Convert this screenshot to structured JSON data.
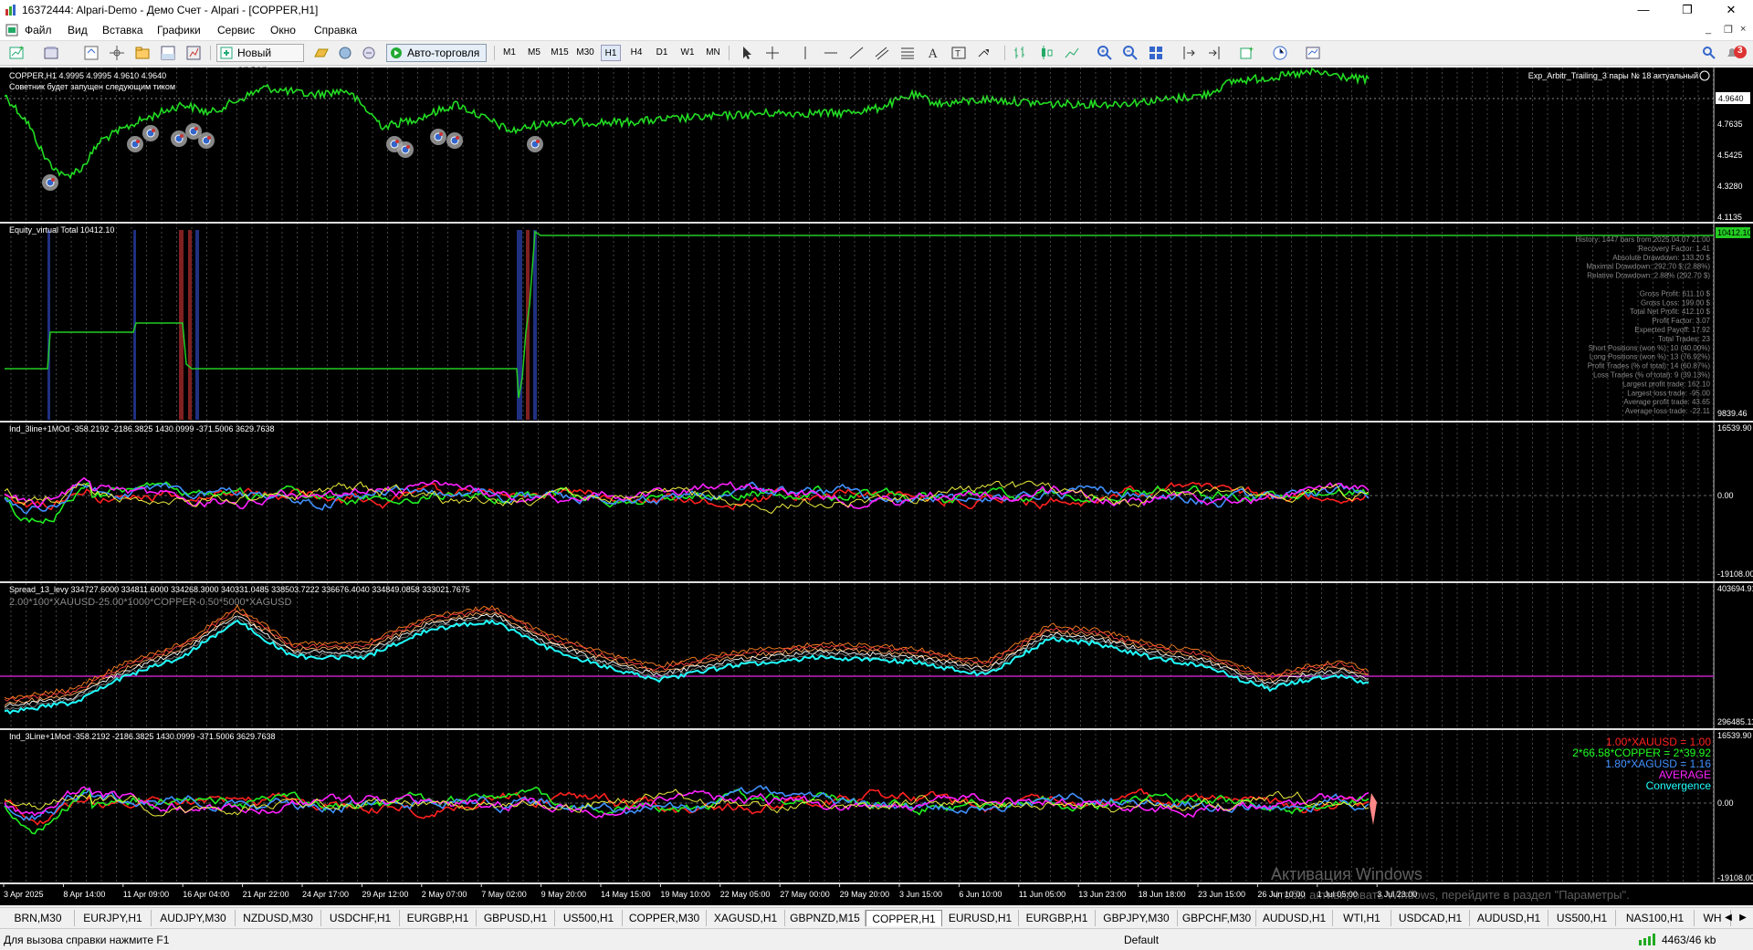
{
  "window": {
    "title": "16372444: Alpari-Demo - Демо Счет - Alpari - [COPPER,H1]",
    "controls": [
      "—",
      "❐",
      "✕"
    ],
    "mdi_controls": [
      "_",
      "❐",
      "×"
    ]
  },
  "menu": [
    "Файл",
    "Вид",
    "Вставка",
    "Графики",
    "Сервис",
    "Окно",
    "Справка"
  ],
  "toolbar": {
    "new_order": "Новый ордер",
    "autotrading": "Авто-торговля",
    "timeframes": [
      "M1",
      "M5",
      "M15",
      "M30",
      "H1",
      "H4",
      "D1",
      "W1",
      "MN"
    ],
    "active_timeframe": "H1",
    "notification_count": "3"
  },
  "chart": {
    "symbol_header": "COPPER,H1  4.9995 4.9995 4.9610 4.9640",
    "ea_notice": "Советник будет запущен следующим тиком",
    "ea_name": "Exp_Arbitr_Trailing_3 пары № 18 актуальный",
    "current_price": "4.9640",
    "price_axis_main": [
      "4.9640",
      "4.7635",
      "4.5425",
      "4.3280",
      "4.1135"
    ],
    "equity_label": "Equity_virtual Total 10412.10",
    "equity_axis": [
      "10412.10",
      "9839.46"
    ],
    "stats": [
      "History: 1447 bars from 2025.04.07 21:00",
      "Recovery Factor: 1.41",
      "Absolute Drawdown: 133.20 $",
      "Maximal Drawdown: 292.70 $ (2.88%)",
      "Relative Drawdown: 2.88% (292.70 $)",
      "",
      "Gross Profit: 611.10 $",
      "Gross Loss: 199.00 $",
      "Total Net Profit: 412.10 $",
      "Profit Factor: 3.07",
      "Expected Payoff: 17.92",
      "Total Trades: 23",
      "Short Positions (won %): 10 (40.00%)",
      "Long Positions (won %): 13 (76.92%)",
      "Profit Trades (% of total): 14 (60.87%)",
      "Loss Trades (% of total): 9 (39.13%)",
      "Largest profit trade: 162.10",
      "Largest loss trade: -95.00",
      "Average profit trade: 43.65",
      "Average loss trade: -22.11"
    ],
    "ind1_label": "Ind_3line+1MOd -358.2192 -2186.3825 1430.0999 -371.5006 3629.7638",
    "ind1_axis": [
      "16539.90",
      "0.00",
      "-19108.00"
    ],
    "spread_label": "Spread_13_levy 334727.6000 334811.6000 334268.3000 340331.0485 338503.7222 336676.4040 334849.0858 333021.7675",
    "spread_formula": "2.00*100*XAUUSD-25.00*1000*COPPER-0.50*5000*XAGUSD",
    "spread_axis": [
      "403694.91",
      "296485.11"
    ],
    "ind2_label": "Ind_3Line+1Mod -358.2192 -2186.3825 1430.0999 -371.5006 3629.7638",
    "ind2_axis": [
      "16539.90",
      "0.00",
      "-19108.00"
    ],
    "legend": [
      {
        "text": "1.00*XAUUSD = 1.00",
        "color": "#ff2020"
      },
      {
        "text": "2*66.58*COPPER = 2*39.92",
        "color": "#20ff20"
      },
      {
        "text": "1.80*XAGUSD = 1.16",
        "color": "#4090ff"
      },
      {
        "text": "AVERAGE",
        "color": "#ff20ff"
      },
      {
        "text": "Convergence",
        "color": "#20ffff"
      }
    ],
    "time_axis": [
      "3 Apr 2025",
      "8 Apr 14:00",
      "11 Apr 09:00",
      "16 Apr 04:00",
      "21 Apr 22:00",
      "24 Apr 17:00",
      "29 Apr 12:00",
      "2 May 07:00",
      "7 May 02:00",
      "9 May 20:00",
      "14 May 15:00",
      "19 May 10:00",
      "22 May 05:00",
      "27 May 00:00",
      "29 May 20:00",
      "3 Jun 15:00",
      "6 Jun 10:00",
      "11 Jun 05:00",
      "13 Jun 23:00",
      "18 Jun 18:00",
      "23 Jun 15:00",
      "26 Jun 10:00",
      "1 Jul 05:00",
      "3 Jul 23:00"
    ],
    "watermark_title": "Активация Windows",
    "watermark_sub": "Чтобы активировать Windows, перейдите в раздел \"Параметры\"."
  },
  "tabs": [
    "BRN,M30",
    "EURJPY,H1",
    "AUDJPY,M30",
    "NZDUSD,M30",
    "USDCHF,H1",
    "EURGBP,H1",
    "GBPUSD,H1",
    "US500,H1",
    "COPPER,M30",
    "XAGUSD,H1",
    "GBPNZD,M15",
    "COPPER,H1",
    "EURUSD,H1",
    "EURGBP,H1",
    "GBPJPY,M30",
    "GBPCHF,M30",
    "AUDUSD,H1",
    "WTI,H1",
    "USDCAD,H1",
    "AUDUSD,H1",
    "US500,H1",
    "NAS100,H1",
    "WH"
  ],
  "active_tab": "COPPER,H1",
  "status": {
    "help": "Для вызова справки нажмите F1",
    "profile": "Default",
    "traffic": "4463/46 kb"
  }
}
